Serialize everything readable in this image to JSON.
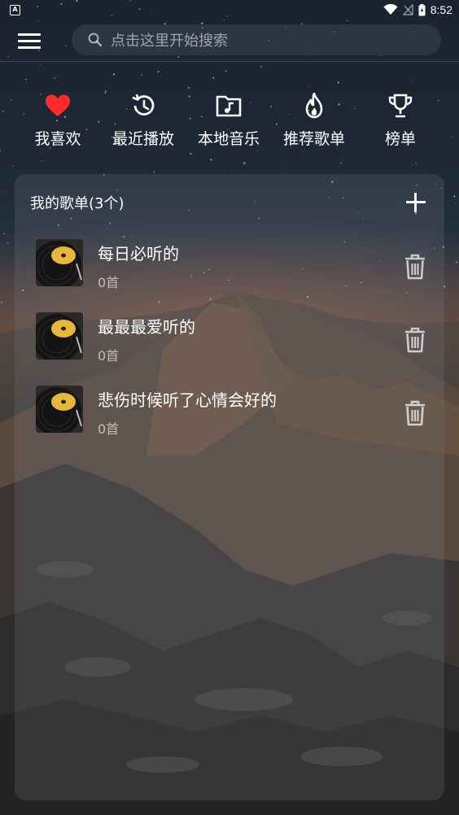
{
  "status_bar": {
    "badge": "A",
    "time": "8:52"
  },
  "search": {
    "placeholder": "点击这里开始搜索"
  },
  "quick_nav": [
    {
      "label": "我喜欢",
      "icon": "heart-icon"
    },
    {
      "label": "最近播放",
      "icon": "history-icon"
    },
    {
      "label": "本地音乐",
      "icon": "music-folder-icon"
    },
    {
      "label": "推荐歌单",
      "icon": "fire-icon"
    },
    {
      "label": "榜单",
      "icon": "trophy-icon"
    }
  ],
  "playlists": {
    "header": "我的歌单(3个)",
    "items": [
      {
        "name": "每日必听的",
        "count": "0首"
      },
      {
        "name": "最最最爱听的",
        "count": "0首"
      },
      {
        "name": "悲伤时候听了心情会好的",
        "count": "0首"
      }
    ]
  },
  "colors": {
    "accent_heart": "#ff2b2b",
    "text_primary": "#ffffff",
    "text_secondary": "rgba(255,255,255,0.6)"
  }
}
